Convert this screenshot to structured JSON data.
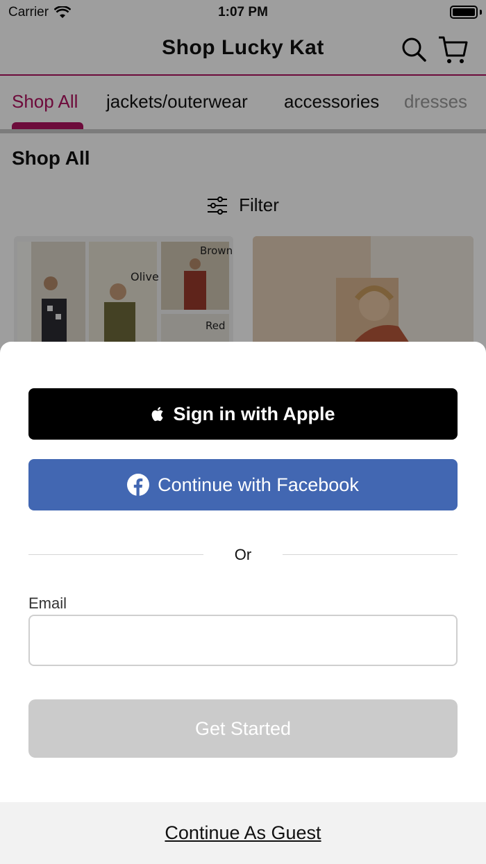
{
  "status_bar": {
    "carrier": "Carrier",
    "time": "1:07 PM",
    "battery_level": 1.0
  },
  "header": {
    "title": "Shop Lucky Kat",
    "icons": [
      "search-icon",
      "cart-icon"
    ]
  },
  "tabs": [
    {
      "label": "Shop All",
      "active": true
    },
    {
      "label": "jackets/outerwear",
      "active": false
    },
    {
      "label": "accessories",
      "active": false
    },
    {
      "label": "dresses",
      "active": false
    }
  ],
  "page": {
    "section_title": "Shop All",
    "filter_label": "Filter",
    "product_photo_captions": [
      "Olive",
      "Brown",
      "Red"
    ]
  },
  "sheet": {
    "apple_button": "Sign in with Apple",
    "facebook_button": "Continue with Facebook",
    "or_text": "Or",
    "email_label": "Email",
    "email_value": "",
    "get_started_button": "Get Started",
    "guest_link": "Continue As Guest"
  },
  "colors": {
    "brand_accent": "#b0135f",
    "facebook_blue": "#4267b2",
    "apple_black": "#000000",
    "disabled_gray": "#cbcbcb"
  }
}
